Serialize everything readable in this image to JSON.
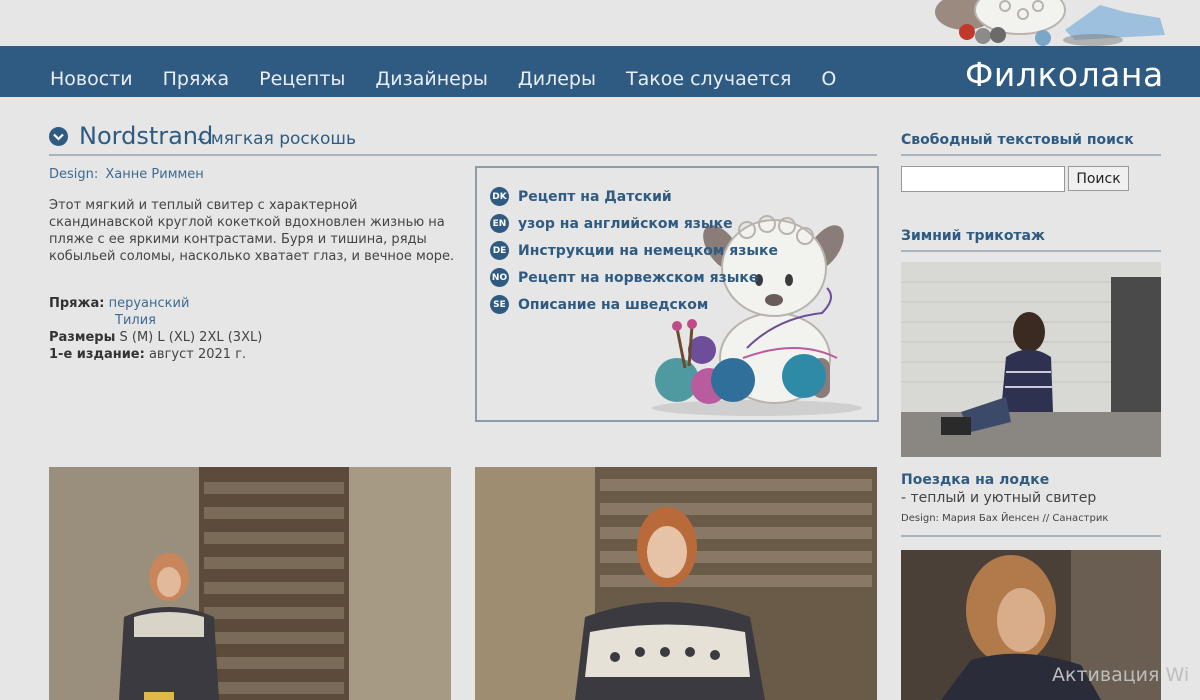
{
  "nav": {
    "items": [
      "Новости",
      "Пряжа",
      "Рецепты",
      "Дизайнеры",
      "Дилеры",
      "Такое случается",
      "О"
    ],
    "brand": "Филколана"
  },
  "product": {
    "title": "Nordstrand",
    "subtitle": "– мягкая роскошь",
    "design_label": "Design:",
    "designer": "Ханне Риммен",
    "description": "Этот мягкий и теплый свитер с характерной скандинавской круглой кокеткой вдохновлен жизнью на пляже с ее яркими контрастами. Буря и тишина, ряды кобыльей соломы, насколько хватает глаз, и вечное море.",
    "yarn_label": "Пряжа:",
    "yarns": [
      "перуанский",
      "Тилия"
    ],
    "sizes_label": "Размеры",
    "sizes": "S (M) L (XL) 2XL (3XL)",
    "edition_label": "1-е издание:",
    "edition": "август 2021 г."
  },
  "languages": [
    {
      "code": "DK",
      "label": "Рецепт на Датский"
    },
    {
      "code": "EN",
      "label": "узор на английском языке"
    },
    {
      "code": "DE",
      "label": "Инструкции на немецком языке"
    },
    {
      "code": "NO",
      "label": "Рецепт на норвежском языке"
    },
    {
      "code": "SE",
      "label": "Описание на шведском"
    }
  ],
  "sidebar": {
    "search_heading": "Свободный текстовый поиск",
    "search_placeholder": "",
    "search_button": "Поиск",
    "winter_heading": "Зимний трикотаж",
    "boat_title": "Поездка на лодке",
    "boat_subtitle": "- теплый и уютный свитер",
    "boat_design": "Design: Мария Бах Йенсен // Санастрик"
  },
  "watermark": "Активация Wi",
  "colors": {
    "nav_bg": "#2f5b82",
    "accent": "#2f5b82",
    "page_bg": "#e6e6e6"
  },
  "icons": [
    "chevron-down-icon",
    "sheep-mascot-illustration",
    "language-badge-icon"
  ]
}
